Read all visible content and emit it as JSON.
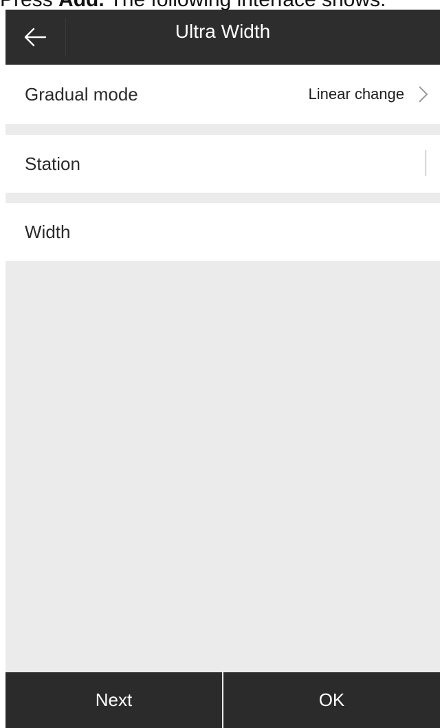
{
  "caption": {
    "prefix": "Press ",
    "bold": "Add.",
    "suffix": " The following interface shows."
  },
  "header": {
    "title": "Ultra Width",
    "back_icon": "arrow-left-icon"
  },
  "form": {
    "gradual_mode": {
      "label": "Gradual mode",
      "value": "Linear change",
      "icon": "chevron-right-icon"
    },
    "station": {
      "label": "Station",
      "value": ""
    },
    "width": {
      "label": "Width",
      "value": ""
    }
  },
  "footer": {
    "next_label": "Next",
    "ok_label": "OK"
  },
  "colors": {
    "appbar": "#2d2d2d",
    "background": "#ebebeb",
    "footer": "#2b2b2b"
  }
}
